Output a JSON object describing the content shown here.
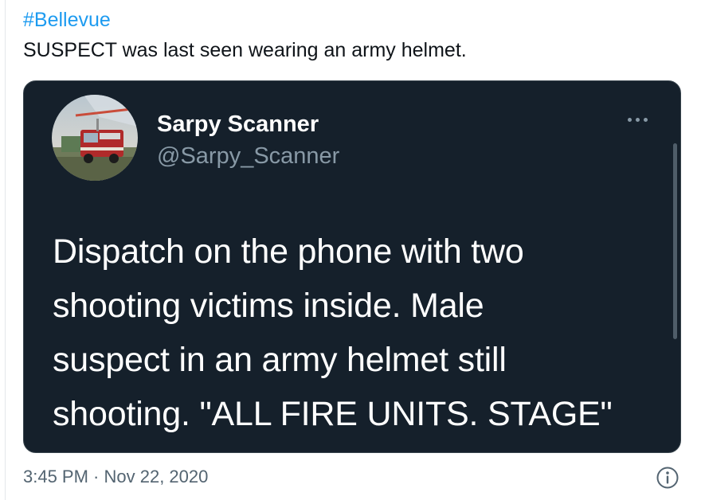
{
  "tweet": {
    "hashtag": "#Bellevue",
    "text": "SUSPECT was last seen wearing an army helmet.",
    "timestamp": "3:45 PM · Nov 22, 2020"
  },
  "quoted_tweet": {
    "display_name": "Sarpy Scanner",
    "handle": "@Sarpy_Scanner",
    "body_lines": [
      "Dispatch on the phone with two",
      "shooting victims inside. Male",
      "suspect in an army helmet still",
      "shooting. \"ALL FIRE UNITS. STAGE\""
    ],
    "avatar_icon": "fire-truck-avatar",
    "more_icon": "more-options-icon"
  },
  "icons": {
    "info": "info-icon"
  },
  "colors": {
    "link": "#1d9bf0",
    "card_background": "#15202b",
    "secondary_text_dark": "#8899a6",
    "secondary_text_light": "#536471"
  }
}
